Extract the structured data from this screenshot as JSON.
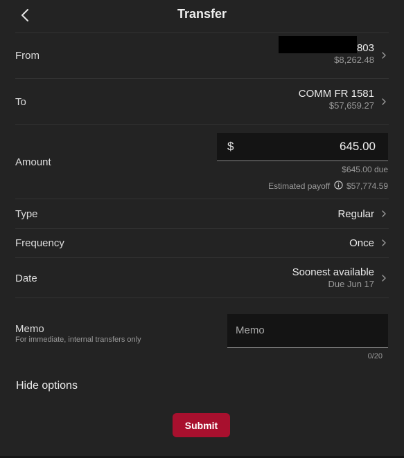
{
  "header": {
    "title": "Transfer",
    "back_icon": "chevron-left-icon"
  },
  "from": {
    "label": "From",
    "account": "803",
    "balance": "$8,262.48"
  },
  "to": {
    "label": "To",
    "account": "COMM FR 1581",
    "balance": "$57,659.27"
  },
  "amount": {
    "label": "Amount",
    "currency_symbol": "$",
    "value": "645.00",
    "due": "$645.00 due",
    "payoff_label": "Estimated payoff",
    "payoff_value": "$57,774.59"
  },
  "type": {
    "label": "Type",
    "value": "Regular"
  },
  "frequency": {
    "label": "Frequency",
    "value": "Once"
  },
  "date": {
    "label": "Date",
    "value": "Soonest available",
    "due": "Due Jun 17"
  },
  "memo": {
    "label": "Memo",
    "hint": "For immediate, internal transfers only",
    "placeholder": "Memo",
    "value": "",
    "counter": "0/20"
  },
  "options_toggle": "Hide options",
  "submit_label": "Submit",
  "colors": {
    "background": "#232323",
    "submit": "#a8102e",
    "muted_text": "#9a9a9a"
  }
}
